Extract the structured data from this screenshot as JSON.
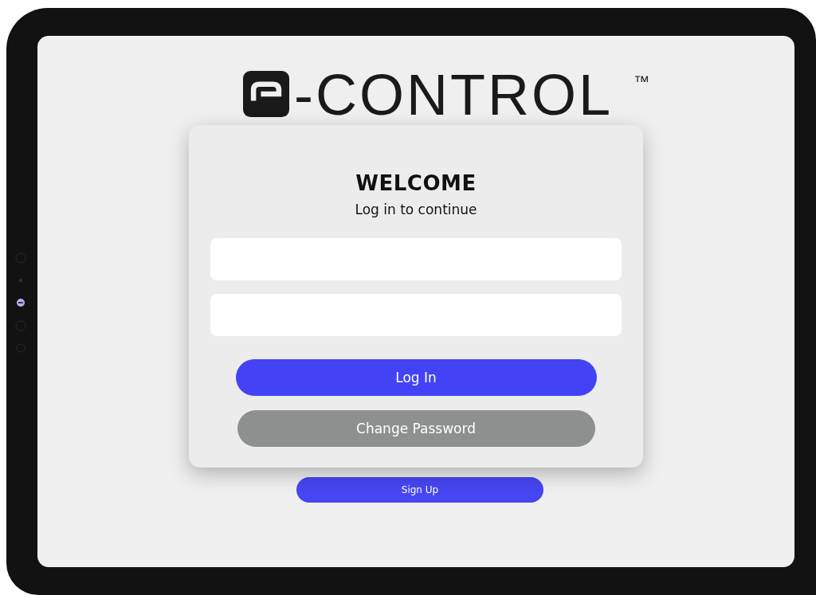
{
  "logo": {
    "text": "-CONTROL",
    "trademark": "™"
  },
  "card": {
    "title": "WELCOME",
    "subtitle": "Log in to continue",
    "buttons": [
      {
        "label": "Log In",
        "kind": "primary"
      },
      {
        "label": "Change Password",
        "kind": "secondary"
      }
    ]
  },
  "sign_up": {
    "label": "Sign Up"
  }
}
